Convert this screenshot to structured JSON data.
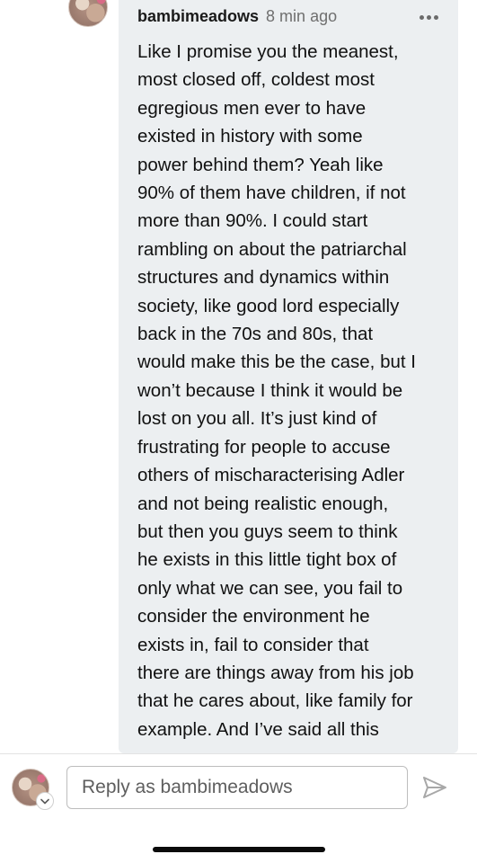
{
  "comment": {
    "username": "bambimeadows",
    "timestamp": "8 min ago",
    "more_icon": "more-horizontal-icon",
    "lines": [
      "Like I promise you the meanest,",
      "most closed off, coldest most",
      "egregious men ever to have",
      "existed in history with some",
      "power behind them? Yeah like",
      "90% of them have children, if not",
      "more than 90%. I could start",
      "rambling on about the patriarchal",
      "structures and dynamics within",
      "society, like good lord especially",
      "back in the 70s and 80s, that",
      "would make this be the case, but I",
      "won’t because I think it would be",
      "lost on you all. It’s just kind of",
      "frustrating for people to accuse",
      "others of mischaracterising Adler",
      "and not being realistic enough,",
      "but then you guys seem to think",
      "he exists in this little tight box of",
      "only what we can see, you fail to",
      "consider the environment he",
      "exists in, fail to consider that",
      "there are things away from his job",
      "that he cares about, like family for",
      "example. And I’ve said all this"
    ]
  },
  "composer": {
    "placeholder": "Reply as bambimeadows",
    "avatar_icon": "user-avatar",
    "switch_icon": "chevron-down-icon",
    "send_icon": "send-arrow-icon"
  },
  "colors": {
    "bubble_bg": "#eceff1",
    "timestamp": "#6f6f6f",
    "input_border": "#bdbdbd"
  }
}
